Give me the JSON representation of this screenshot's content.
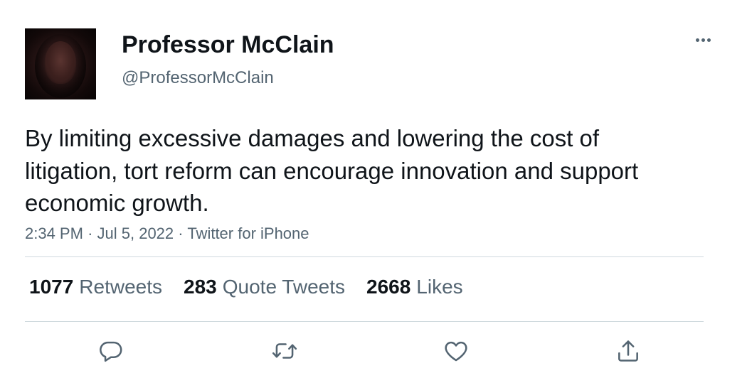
{
  "user": {
    "display_name": "Professor McClain",
    "handle": "@ProfessorMcClain"
  },
  "tweet": {
    "text": "By limiting excessive damages and lowering the cost of litigation, tort reform can encourage innovation and support economic growth.",
    "time": "2:34 PM",
    "date": "Jul 5, 2022",
    "source": "Twitter for iPhone",
    "separator": "·"
  },
  "stats": {
    "retweets_count": "1077",
    "retweets_label": "Retweets",
    "quotes_count": "283",
    "quotes_label": "Quote Tweets",
    "likes_count": "2668",
    "likes_label": "Likes"
  },
  "actions": {
    "reply": "reply-icon",
    "retweet": "retweet-icon",
    "like": "heart-icon",
    "share": "share-icon"
  },
  "colors": {
    "text_primary": "#0f1419",
    "text_secondary": "#536471",
    "divider": "#cfd9de"
  }
}
